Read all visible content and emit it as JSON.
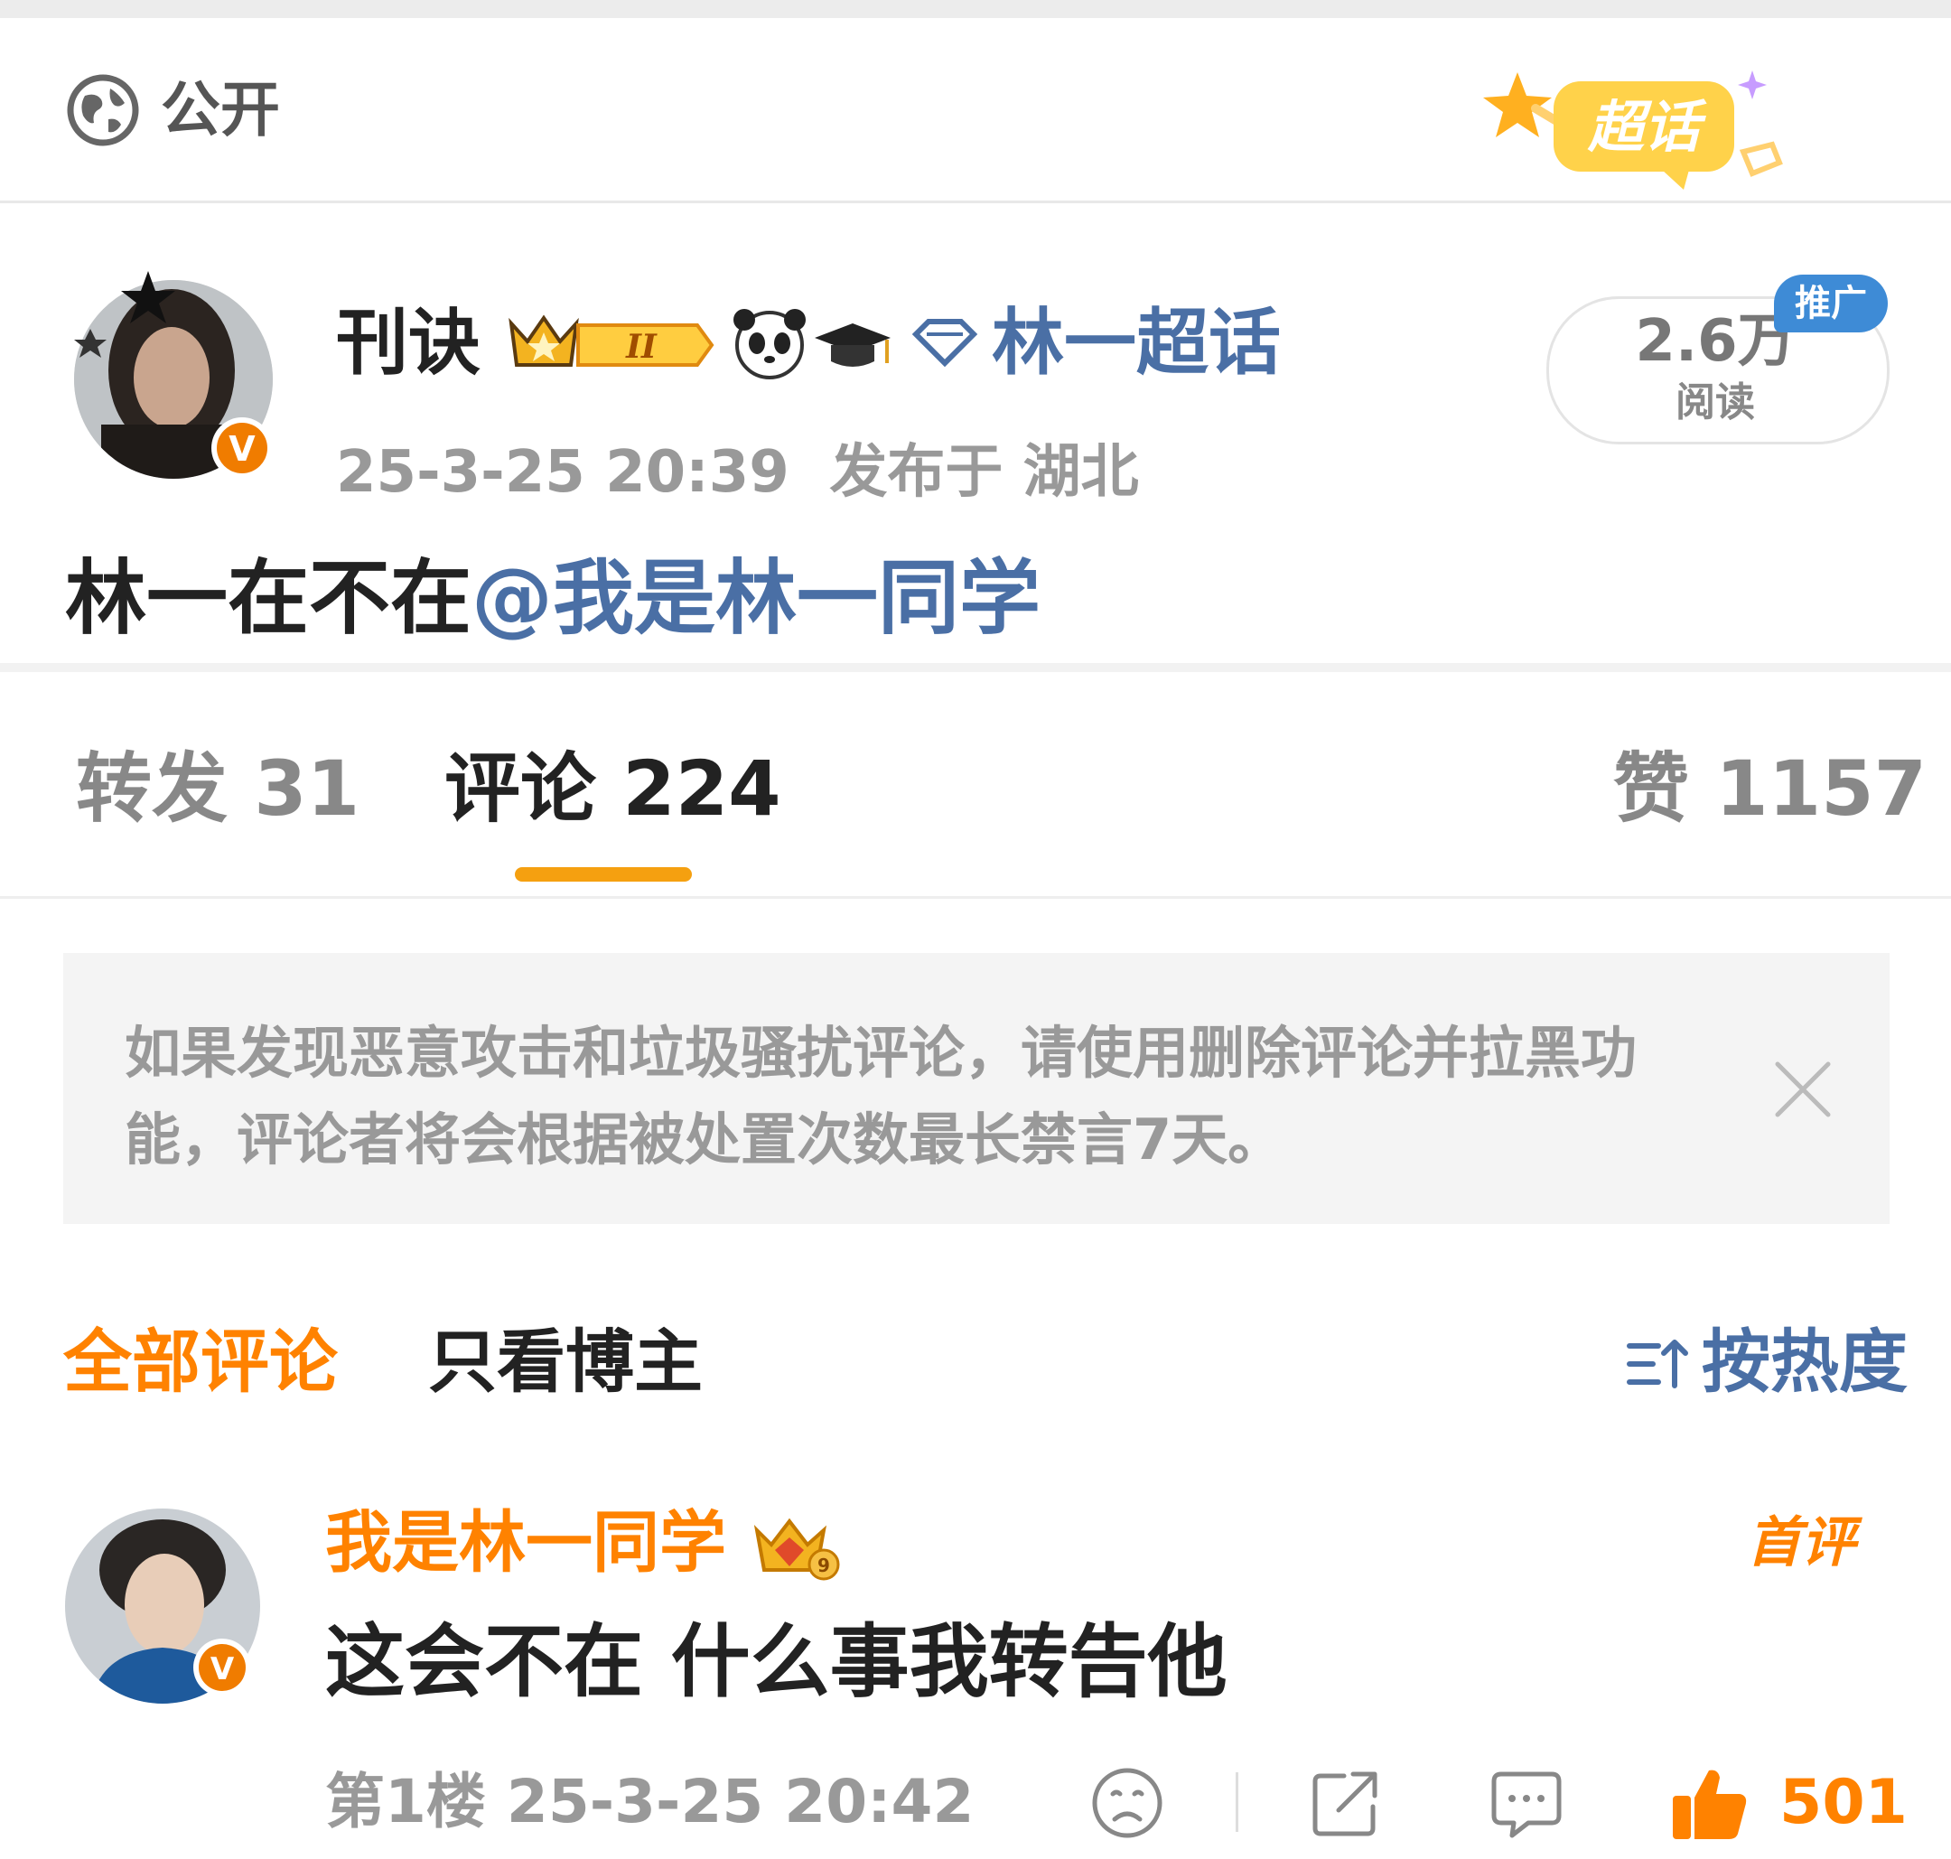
{
  "privacy": {
    "label": "公开",
    "icon": "globe-icon"
  },
  "supertopic_badge": {
    "label": "超话"
  },
  "post": {
    "author": "刊诀",
    "topic": "林一超话",
    "time": "25-3-25 20:39",
    "location": "发布于 湖北",
    "reads_count": "2.6万",
    "reads_label": "阅读",
    "promo_badge": "推广",
    "body_text": "林一在不在",
    "mention": "@我是林一同学"
  },
  "tabs": {
    "repost": "转发 31",
    "comment": "评论 224",
    "like": "赞 1157"
  },
  "notice": {
    "text": "如果发现恶意攻击和垃圾骚扰评论，请使用删除评论并拉黑功能，评论者将会根据被处置次数最长禁言7天。"
  },
  "filters": {
    "all": "全部评论",
    "author_only": "只看博主",
    "sort": "按热度"
  },
  "comment": {
    "user": "我是林一同学",
    "badge": "首评",
    "text": "这会不在 什么事我转告他",
    "floor_time": "第1楼 25-3-25 20:42",
    "likes": "501"
  },
  "colors": {
    "accent_orange": "#ff8200",
    "link_blue": "#4a6fa5",
    "verified_orange": "#f07c00",
    "tab_underline": "#f5a010"
  }
}
